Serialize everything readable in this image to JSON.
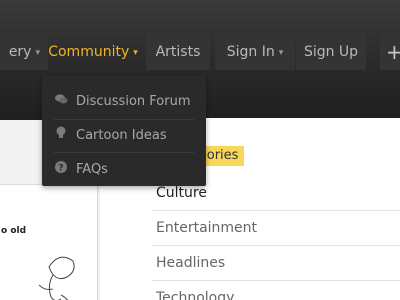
{
  "nav": {
    "gallery_label": "ery",
    "community_label": "Community",
    "artists_label": "Artists",
    "signin_label": "Sign In",
    "signup_label": "Sign Up",
    "caret": "▾",
    "plus": "+"
  },
  "dropdown": {
    "items": [
      {
        "label": "Discussion Forum",
        "icon": "speech-bubbles-icon",
        "glyph": "💬"
      },
      {
        "label": "Cartoon Ideas",
        "icon": "lightbulb-icon",
        "glyph": "💡"
      },
      {
        "label": "FAQs",
        "icon": "question-circle-icon",
        "glyph": "?"
      }
    ]
  },
  "content": {
    "categories_heading": "n Categories",
    "comic_text": "o old",
    "categories": [
      "Culture",
      "Entertainment",
      "Headlines",
      "Technology"
    ]
  },
  "colors": {
    "accent": "#f0b429",
    "heading_highlight": "#f7d65a",
    "header_bg": "#2b2b2b"
  }
}
